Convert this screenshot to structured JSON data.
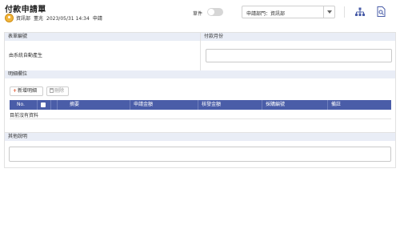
{
  "page": {
    "title": "付款申請單"
  },
  "user": {
    "department": "資訊部",
    "name": "董兆",
    "datetime": "2023/05/31 14:34",
    "status": "申請"
  },
  "toolbar": {
    "draft_label": "草件",
    "draft_on": false,
    "department_select": "申請部門：資訊部",
    "icons": [
      "org-chart-icon",
      "document-search-icon"
    ]
  },
  "form": {
    "form_number_label": "表單編號",
    "form_number_value": "由系統自動產生",
    "payment_month_label": "付款月份",
    "payment_month_value": ""
  },
  "details": {
    "section_label": "明細欄位",
    "add_button": "新增明細",
    "delete_button": "刪除",
    "columns": [
      "No.",
      "",
      "摘要",
      "申請金額",
      "核發金額",
      "採購編號",
      "備註"
    ],
    "empty_text": "目前沒有資料"
  },
  "notes": {
    "section_label": "其他說明",
    "value": ""
  },
  "colors": {
    "table_header": "#4a5da8",
    "section_header": "#e9edf6",
    "accent": "#e0542c",
    "avatar": "#f1b53d"
  }
}
